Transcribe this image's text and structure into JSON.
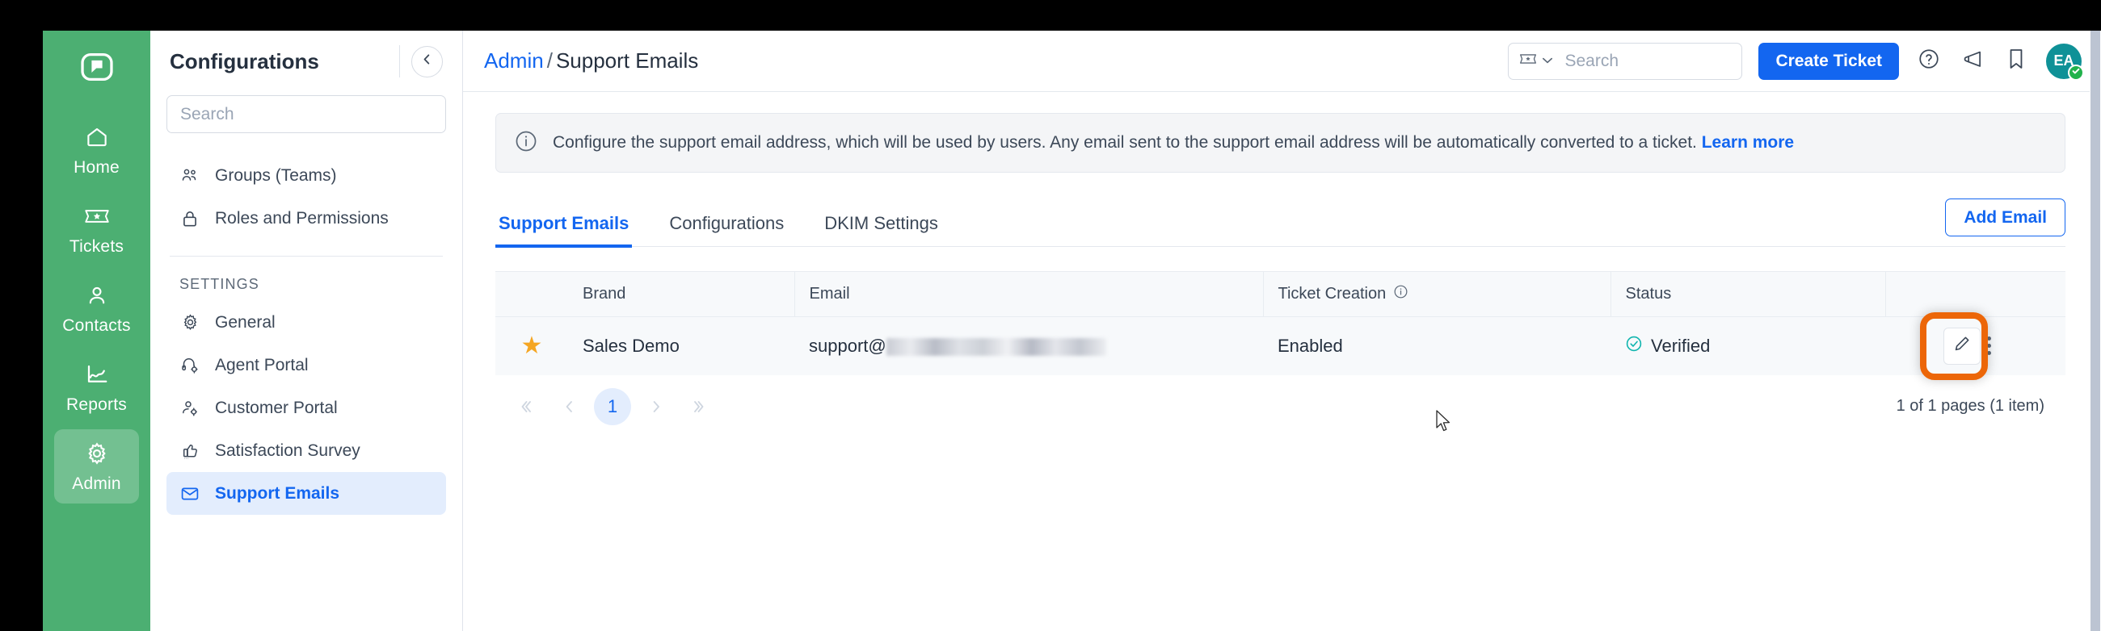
{
  "rail": {
    "logo_icon": "chat-bubble-logo",
    "items": [
      {
        "label": "Home",
        "icon": "home-icon",
        "active": false
      },
      {
        "label": "Tickets",
        "icon": "ticket-icon",
        "active": false
      },
      {
        "label": "Contacts",
        "icon": "person-icon",
        "active": false
      },
      {
        "label": "Reports",
        "icon": "chart-line-icon",
        "active": false
      },
      {
        "label": "Admin",
        "icon": "gear-icon",
        "active": true
      }
    ]
  },
  "configurations": {
    "title": "Configurations",
    "collapse_icon": "chevron-left-icon",
    "search_placeholder": "Search",
    "search_value": "",
    "top_items": [
      {
        "label": "Groups (Teams)",
        "icon": "people-group-icon"
      },
      {
        "label": "Roles and Permissions",
        "icon": "lock-icon"
      }
    ],
    "section_label": "SETTINGS",
    "settings_items": [
      {
        "label": "General",
        "icon": "gear-icon",
        "active": false
      },
      {
        "label": "Agent Portal",
        "icon": "headset-gear-icon",
        "active": false
      },
      {
        "label": "Customer Portal",
        "icon": "person-gear-icon",
        "active": false
      },
      {
        "label": "Satisfaction Survey",
        "icon": "thumbs-up-icon",
        "active": false
      },
      {
        "label": "Support Emails",
        "icon": "envelope-icon",
        "active": true
      }
    ]
  },
  "topbar": {
    "breadcrumb_root": "Admin",
    "breadcrumb_separator": "/",
    "breadcrumb_current": "Support Emails",
    "search_placeholder": "Search",
    "search_value": "",
    "search_type_icon": "ticket-icon",
    "search_type_caret": "chevron-down-icon",
    "filter_icon": "funnel-icon",
    "create_ticket_label": "Create Ticket",
    "help_icon": "question-circle-icon",
    "announcement_icon": "megaphone-icon",
    "bookmark_icon": "bookmark-icon",
    "avatar_initials": "EA",
    "avatar_badge_icon": "check-circle-icon",
    "avatar_color": "#0f9197",
    "badge_color": "#21b24b"
  },
  "banner": {
    "icon": "info-circle-icon",
    "text": "Configure the support email address, which will be used by users. Any email sent to the support email address will be automatically converted to a ticket.",
    "link_label": "Learn more"
  },
  "tabs": [
    {
      "label": "Support Emails",
      "active": true
    },
    {
      "label": "Configurations",
      "active": false
    },
    {
      "label": "DKIM Settings",
      "active": false
    }
  ],
  "add_email_label": "Add Email",
  "table": {
    "columns": [
      "",
      "Brand",
      "Email",
      "Ticket Creation",
      "Status",
      ""
    ],
    "ticket_creation_info_icon": "info-circle-icon",
    "rows": [
      {
        "favorite_icon": "star-filled-icon",
        "brand": "Sales Demo",
        "email_prefix": "support@",
        "email_redacted": true,
        "ticket_creation": "Enabled",
        "status": "Verified",
        "status_icon": "check-circle-icon",
        "status_color": "#0fb5ae",
        "edit_icon": "pencil-icon",
        "more_icon": "kebab-menu-icon"
      }
    ]
  },
  "pagination": {
    "first_icon": "double-chevron-left-icon",
    "prev_icon": "chevron-left-icon",
    "current_page": "1",
    "next_icon": "chevron-right-icon",
    "last_icon": "double-chevron-right-icon",
    "page_info": "1 of 1 pages (1 item)"
  },
  "highlight": {
    "color": "#ec6608",
    "target": "edit-button"
  }
}
